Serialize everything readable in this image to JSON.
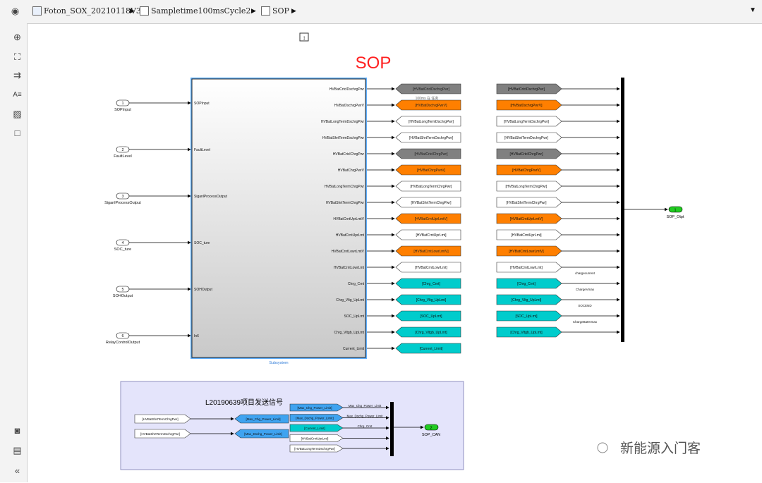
{
  "breadcrumb": {
    "model": "Foton_SOX_20210118V3",
    "level1": "Sampletime100msCycle2",
    "level2": "SOP"
  },
  "title": "SOP",
  "note_label": "100ms 在 任务",
  "subsystem_label": "Subsystem",
  "inports": [
    {
      "num": "1",
      "name": "SOPInput"
    },
    {
      "num": "2",
      "name": "FaultLevel"
    },
    {
      "num": "3",
      "name": "SiganlProcessOutput"
    },
    {
      "num": "4",
      "name": "SOC_ture"
    },
    {
      "num": "5",
      "name": "SOHOutput"
    },
    {
      "num": "6",
      "name": "RelayControlOutput"
    }
  ],
  "subsystem_inputs": [
    "SOPInput",
    "FaultLevel",
    "SiganlProcessOutput",
    "SOC_ture",
    "SOHOutput",
    "In6"
  ],
  "outputs": [
    {
      "port": "HVBatCrtclDschrgPwr",
      "tag": "[HVBatCrtclDschrgPwr]",
      "color": "#808080"
    },
    {
      "port": "HVBatDschrgPwrV",
      "tag": "[HVBatDschrgPwrV]",
      "color": "#ff7f00"
    },
    {
      "port": "HVBatLongTermDschrgPwr",
      "tag": "[HVBatLongTermDschrgPwr]",
      "color": "#ffffff"
    },
    {
      "port": "HVBatShrtTermDschrgPwr",
      "tag": "[HVBatShrtTermDschrgPwr]",
      "color": "#ffffff"
    },
    {
      "port": "HVBatCrtclChrgPwr",
      "tag": "[HVBatCrtclChrgPwr]",
      "color": "#808080"
    },
    {
      "port": "HVBatChrgPwrV",
      "tag": "[HVBatChrgPwrV]",
      "color": "#ff7f00"
    },
    {
      "port": "HVBatLongTermChrgPwr",
      "tag": "[HVBatLongTermChrgPwr]",
      "color": "#ffffff"
    },
    {
      "port": "HVBatShrtTermChrgPwr",
      "tag": "[HVBatShrtTermChrgPwr]",
      "color": "#ffffff"
    },
    {
      "port": "HVBatCrntUprLmtV",
      "tag": "[HVBatCrntUprLmtV]",
      "color": "#ff7f00"
    },
    {
      "port": "HVBatCrntUprLmt",
      "tag": "[HVBatCrntUprLmt]",
      "color": "#ffffff"
    },
    {
      "port": "HVBatCrntLowrLmtV",
      "tag": "[HVBatCrntLowrLmtV]",
      "color": "#ff7f00"
    },
    {
      "port": "HVBatCrntLowrLmt",
      "tag": "[HVBatCrntLowrLmt]",
      "color": "#ffffff"
    },
    {
      "port": "Chrg_Crnt",
      "tag": "[Chrg_Crnt]",
      "color": "#00cccc"
    },
    {
      "port": "Chrg_Vltg_UpLmt",
      "tag": "[Chrg_Vltg_UpLmt]",
      "color": "#00cccc"
    },
    {
      "port": "SOC_UpLmt",
      "tag": "[SOC_UpLmt]",
      "color": "#00cccc"
    },
    {
      "port": "Chrg_Vltgb_UpLmt",
      "tag": "[Chrg_Vltgb_UpLmt]",
      "color": "#00cccc"
    },
    {
      "port": "Current_Limit",
      "tag": "[Current_Limit]",
      "color": "#00cccc"
    }
  ],
  "froms_right": [
    {
      "tag": "[HVBatCrtclDschrgPwr]",
      "color": "#808080",
      "sig": ""
    },
    {
      "tag": "[HVBatDschrgPwrV]",
      "color": "#ff7f00",
      "sig": ""
    },
    {
      "tag": "[HVBatLongTermDschrgPwr]",
      "color": "#ffffff",
      "sig": ""
    },
    {
      "tag": "[HVBatShrtTermDschrgPwr]",
      "color": "#ffffff",
      "sig": ""
    },
    {
      "tag": "[HVBatCrtclChrgPwr]",
      "color": "#808080",
      "sig": ""
    },
    {
      "tag": "[HVBatChrgPwrV]",
      "color": "#ff7f00",
      "sig": ""
    },
    {
      "tag": "[HVBatLongTermChrgPwr]",
      "color": "#ffffff",
      "sig": ""
    },
    {
      "tag": "[HVBatShrtTermChrgPwr]",
      "color": "#ffffff",
      "sig": ""
    },
    {
      "tag": "[HVBatCrntUprLmtV]",
      "color": "#ff7f00",
      "sig": ""
    },
    {
      "tag": "[HVBatCrntUprLmt]",
      "color": "#ffffff",
      "sig": ""
    },
    {
      "tag": "[HVBatCrntLowrLmtV]",
      "color": "#ff7f00",
      "sig": ""
    },
    {
      "tag": "[HVBatCrntLowrLmt]",
      "color": "#ffffff",
      "sig": ""
    },
    {
      "tag": "[Chrg_Crnt]",
      "color": "#00cccc",
      "sig": "chargecurrent"
    },
    {
      "tag": "[Chrg_Vltg_UpLmt]",
      "color": "#00cccc",
      "sig": "ChargeVmax"
    },
    {
      "tag": "[SOC_UpLmt]",
      "color": "#00cccc",
      "sig": "SOCEND"
    },
    {
      "tag": "[Chrg_Vltgb_UpLmt]",
      "color": "#00cccc",
      "sig": "ChargeBattVmax"
    }
  ],
  "outport": {
    "num": "1",
    "name": "SOP_Otpt"
  },
  "can_area": {
    "title": "L20190639项目发送信号",
    "froms": [
      {
        "tag": "[HVBatShrtTermChrgPwr]",
        "color": "#ffffff"
      },
      {
        "tag": "[HVBatShrtTermDschrgPwr]",
        "color": "#ffffff"
      }
    ],
    "gotos": [
      {
        "tag": "[Max_Chg_Power_Limit]",
        "color": "#3fa3f0"
      },
      {
        "tag": "[Max_Dschg_Power_Limit]",
        "color": "#3fa3f0"
      }
    ],
    "mux_froms": [
      {
        "tag": "[Max_Chg_Power_Limit]",
        "color": "#3fa3f0",
        "sig": "Max_Chg_Power_Limit"
      },
      {
        "tag": "[Max_Dschg_Power_Limit]",
        "color": "#3fa3f0",
        "sig": "Max_Dschg_Power_Limit"
      },
      {
        "tag": "[Current_Limit]",
        "color": "#00cccc",
        "sig": "Chrg_Crnt"
      },
      {
        "tag": "[HVBatCrntUprLmt]",
        "color": "#ffffff",
        "sig": ""
      },
      {
        "tag": "[HVBatLongTermDschrgPwr]",
        "color": "#ffffff",
        "sig": ""
      }
    ],
    "outport": {
      "num": "2",
      "name": "SOP_CAN"
    }
  },
  "watermark": "新能源入门客"
}
